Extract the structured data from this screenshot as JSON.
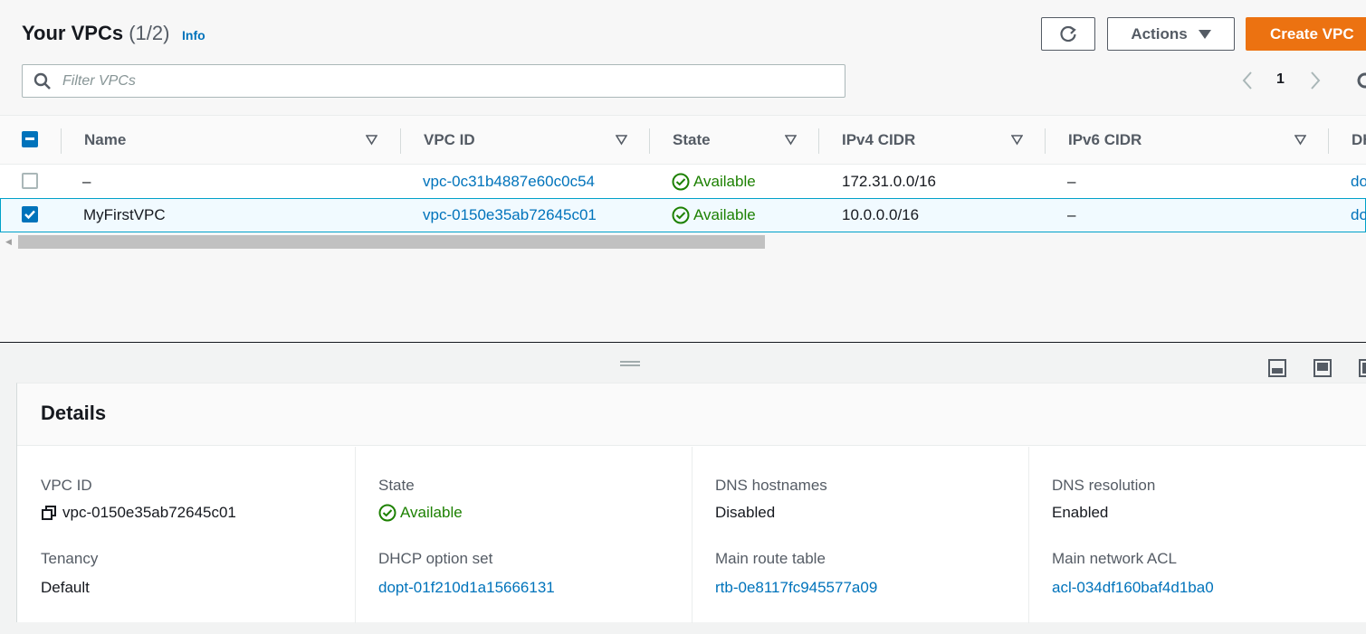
{
  "header": {
    "title": "Your VPCs",
    "count": "(1/2)",
    "info_link": "Info",
    "actions_label": "Actions",
    "create_label": "Create VPC"
  },
  "filter": {
    "placeholder": "Filter VPCs"
  },
  "pagination": {
    "current_page": "1"
  },
  "table": {
    "columns": [
      "Name",
      "VPC ID",
      "State",
      "IPv4 CIDR",
      "IPv6 CIDR",
      "DH"
    ],
    "rows": [
      {
        "selected": false,
        "name": "–",
        "vpc_id": "vpc-0c31b4887e60c0c54",
        "state": "Available",
        "ipv4": "172.31.0.0/16",
        "ipv6": "–",
        "dhcp": "do"
      },
      {
        "selected": true,
        "name": "MyFirstVPC",
        "vpc_id": "vpc-0150e35ab72645c01",
        "state": "Available",
        "ipv4": "10.0.0.0/16",
        "ipv6": "–",
        "dhcp": "do"
      }
    ]
  },
  "details": {
    "title": "Details",
    "fields": [
      {
        "label": "VPC ID",
        "value": "vpc-0150e35ab72645c01"
      },
      {
        "label": "State",
        "value": "Available"
      },
      {
        "label": "DNS hostnames",
        "value": "Disabled"
      },
      {
        "label": "DNS resolution",
        "value": "Enabled"
      },
      {
        "label": "Tenancy",
        "value": "Default"
      },
      {
        "label": "DHCP option set",
        "value": "dopt-01f210d1a15666131"
      },
      {
        "label": "Main route table",
        "value": "rtb-0e8117fc945577a09"
      },
      {
        "label": "Main network ACL",
        "value": "acl-034df160baf4d1ba0"
      }
    ]
  },
  "colors": {
    "accent": "#ec7211",
    "link": "#0073bb",
    "success": "#1d8102",
    "selected_border": "#00a1c9"
  },
  "icons": [
    "refresh-icon",
    "caret-down-icon",
    "search-icon",
    "chevron-left-icon",
    "chevron-right-icon",
    "gear-icon",
    "sort-icon",
    "check-circle-icon",
    "copy-icon",
    "panel-bottom-icon",
    "panel-side-icon",
    "drag-handle-icon"
  ]
}
